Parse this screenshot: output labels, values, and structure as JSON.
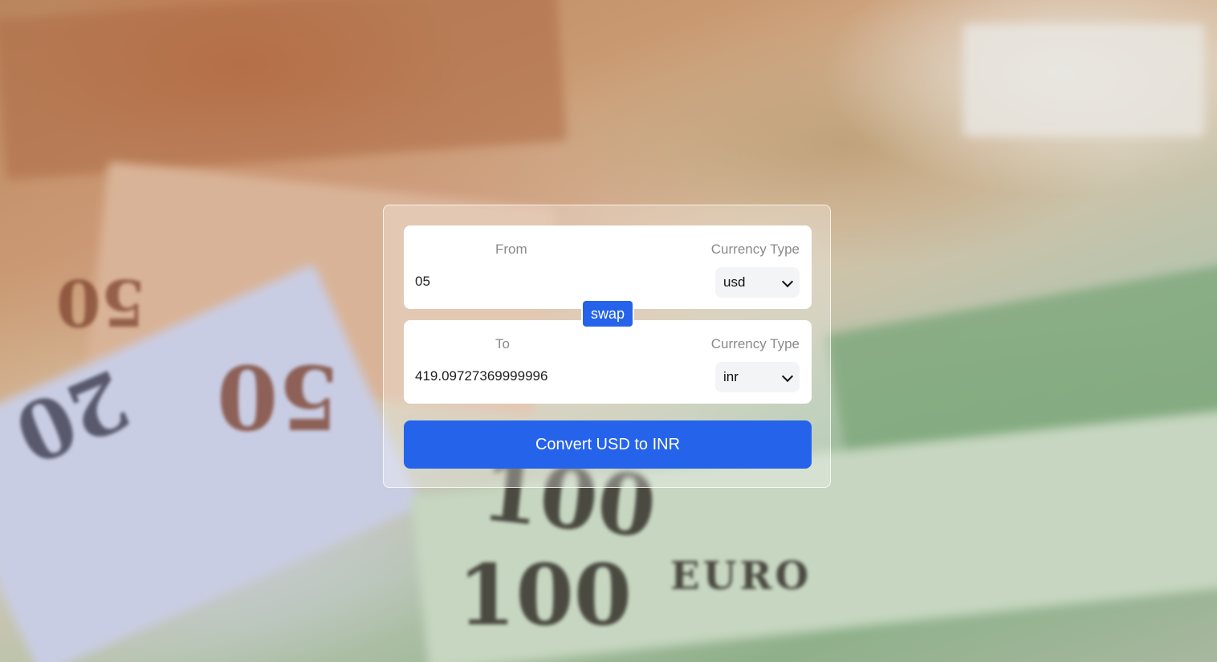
{
  "converter": {
    "from": {
      "label": "From",
      "currency_label": "Currency Type",
      "amount": "05",
      "currency": "usd"
    },
    "swap_label": "swap",
    "to": {
      "label": "To",
      "currency_label": "Currency Type",
      "amount": "419.09727369999996",
      "currency": "inr"
    },
    "convert_label": "Convert USD to INR"
  },
  "background": {
    "banknote_text": [
      "100",
      "EURO",
      "100",
      "20",
      "50",
      "50"
    ]
  },
  "colors": {
    "accent": "#2563eb",
    "panel": "#ffffff",
    "select_bg": "#f3f4f6",
    "label_text": "#8a8a8a"
  }
}
